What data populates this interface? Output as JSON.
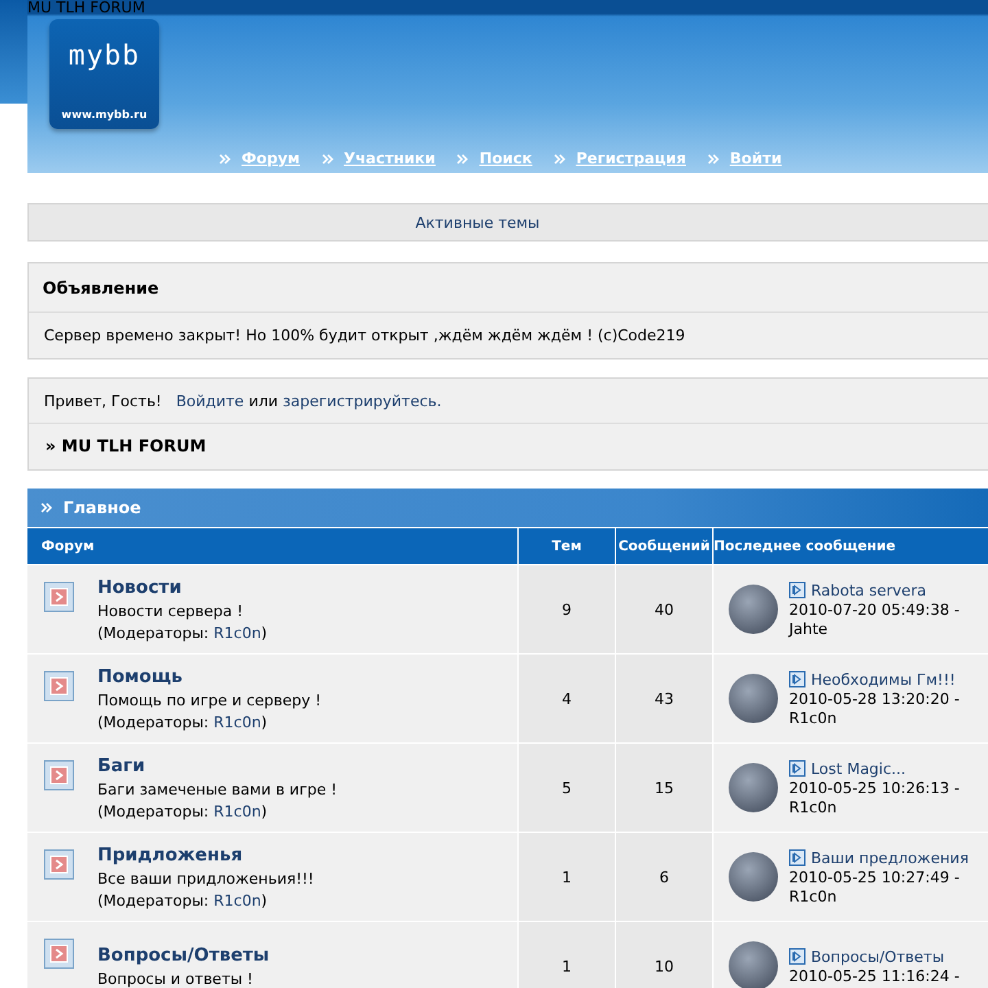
{
  "page_title": "MU TLH FORUM",
  "logo": {
    "text": "mybb",
    "url": "www.mybb.ru"
  },
  "nav": [
    "Форум",
    "Участники",
    "Поиск",
    "Регистрация",
    "Войти"
  ],
  "active_topics": "Активные темы",
  "announcement": {
    "title": "Объявление",
    "text": "Сервер времено закрыт! Но 100% будит открыт ,ждём ждём ждём ! (c)Code219"
  },
  "welcome": {
    "greeting": "Привет, Гость!",
    "login": "Войдите",
    "or": "или",
    "register": "зарегистрируйтесь."
  },
  "breadcrumb": "» MU TLH FORUM",
  "category": {
    "title": "Главное",
    "columns": [
      "Форум",
      "Тем",
      "Сообщений",
      "Последнее сообщение"
    ],
    "forums": [
      {
        "name": "Новости",
        "description": "Новости сервера !",
        "moderators_label": "(Модераторы:",
        "moderator": "R1c0n",
        "moderators_end": ")",
        "topics": "9",
        "posts": "40",
        "last_post": {
          "title": "Rabota servera",
          "date": "2010-07-20 05:49:38 -",
          "author": "Jahte"
        }
      },
      {
        "name": "Помощь",
        "description": "Помощь по игре и серверу !",
        "moderators_label": "(Модераторы:",
        "moderator": "R1c0n",
        "moderators_end": ")",
        "topics": "4",
        "posts": "43",
        "last_post": {
          "title": "Необходимы Гм!!!",
          "date": "2010-05-28 13:20:20 -",
          "author": "R1c0n"
        }
      },
      {
        "name": "Баги",
        "description": "Баги замеченые вами в игре !",
        "moderators_label": "(Модераторы:",
        "moderator": "R1c0n",
        "moderators_end": ")",
        "topics": "5",
        "posts": "15",
        "last_post": {
          "title": "Lost Magic...",
          "date": "2010-05-25 10:26:13 -",
          "author": "R1c0n"
        }
      },
      {
        "name": "Придложенья",
        "description": "Все ваши придложеньия!!!",
        "moderators_label": "(Модераторы:",
        "moderator": "R1c0n",
        "moderators_end": ")",
        "topics": "1",
        "posts": "6",
        "last_post": {
          "title": "Ваши предложения",
          "date": "2010-05-25 10:27:49 -",
          "author": "R1c0n"
        }
      },
      {
        "name": "Вопросы/Ответы",
        "description": "Вопросы и ответы !",
        "topics": "1",
        "posts": "10",
        "last_post": {
          "title": "Вопросы/Ответы",
          "date": "2010-05-25 11:16:24 -"
        }
      }
    ]
  }
}
